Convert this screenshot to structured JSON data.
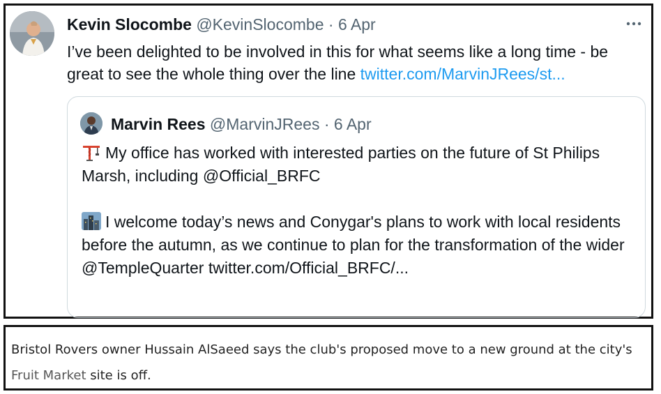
{
  "tweet": {
    "author_name": "Kevin Slocombe",
    "author_handle": "@KevinSlocombe",
    "separator": "·",
    "date": "6 Apr",
    "more_icon": "more-horizontal-icon",
    "text": "I’ve been delighted to be involved in this for what seems like a long time - be great to see the whole thing over the line ",
    "link_text": "twitter.com/MarvinJRees/st..."
  },
  "quoted_tweet": {
    "author_name": "Marvin Rees",
    "author_handle": "@MarvinJRees",
    "separator": "·",
    "date": "6 Apr",
    "paragraph_1": {
      "emoji_icon": "construction-crane-icon",
      "text": "My office has worked with interested parties on the future of St Philips Marsh, including @Official_BRFC"
    },
    "paragraph_2": {
      "emoji_icon": "cityscape-icon",
      "text": "I welcome today’s news and Conygar's plans to work with local residents before the autumn, as we continue to plan for the transformation of the wider @TempleQuarter twitter.com/Official_BRFC/..."
    }
  },
  "caption": {
    "text_before": "Bristol Rovers owner Hussain AlSaeed says the club's proposed move to a new ground at the city's ",
    "link_text": "Fruit Market",
    "text_after": " site is off."
  },
  "colors": {
    "link_blue": "#1d9bf0",
    "secondary_gray": "#536471",
    "border_black": "#111111"
  }
}
